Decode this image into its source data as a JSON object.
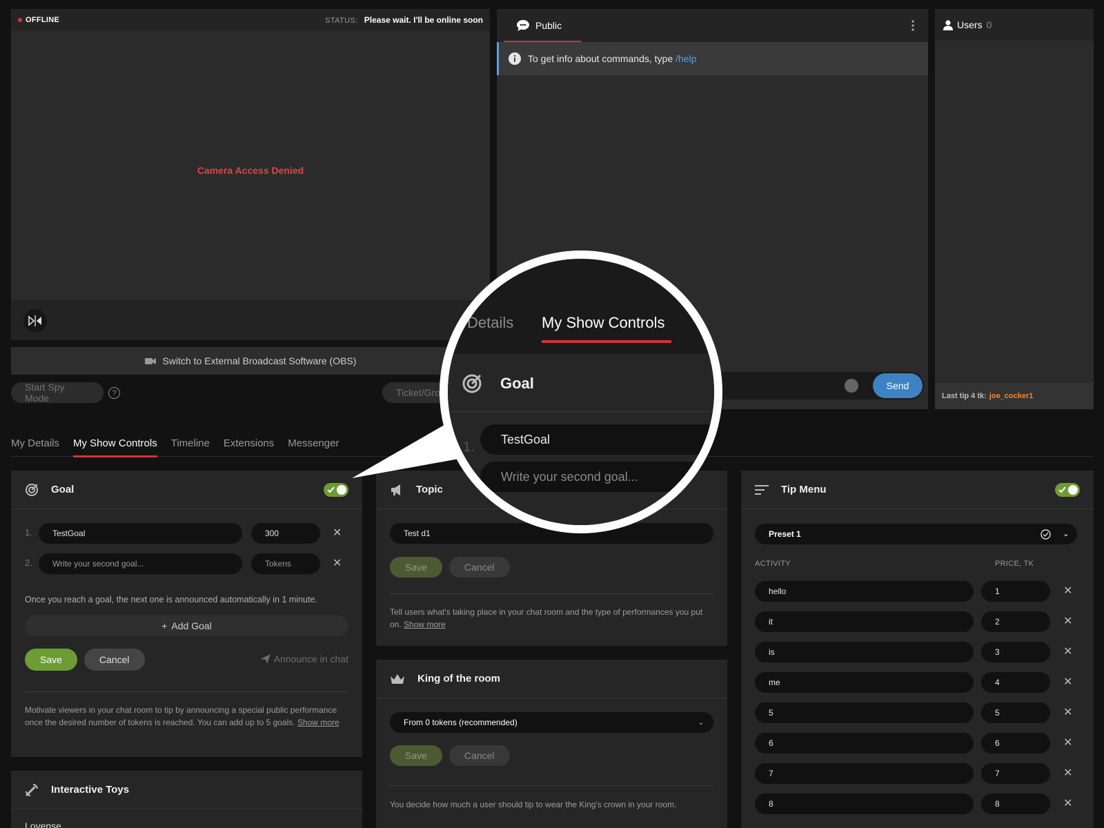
{
  "video": {
    "offline_label": "OFFLINE",
    "status_label": "STATUS:",
    "status_text": "Please wait. I'll be online soon",
    "camera_message": "Camera Access Denied",
    "obs_label": "Switch to External Broadcast Software (OBS)",
    "spy_mode": "Start Spy Mode",
    "help_glyph": "?",
    "ticket_label": "Ticket/Grou"
  },
  "chat": {
    "tab_label": "Public",
    "info_text": "To get info about commands, type",
    "info_command": "/help",
    "send_label": "Send"
  },
  "users": {
    "title": "Users",
    "count": "0",
    "last_tip_label": "Last tip 4 tk:",
    "last_tip_user": "joe_cocker1"
  },
  "tabs": [
    "My Details",
    "My Show Controls",
    "Timeline",
    "Extensions",
    "Messenger"
  ],
  "goal": {
    "title": "Goal",
    "enabled": true,
    "rows": [
      {
        "num": "1.",
        "text": "TestGoal",
        "amount": "300",
        "amount_is_placeholder": false,
        "text_is_placeholder": false
      },
      {
        "num": "2.",
        "text": "Write your second goal...",
        "amount": "Tokens",
        "amount_is_placeholder": true,
        "text_is_placeholder": true
      }
    ],
    "note": "Once you reach a goal, the next one is announced automatically in 1 minute.",
    "add_label": "Add Goal",
    "save": "Save",
    "cancel": "Cancel",
    "announce": "Announce in chat",
    "description": "Motivate viewers in your chat room to tip by announcing a special public performance once the desired number of tokens is reached. You can add up to 5 goals.",
    "show_more": "Show more"
  },
  "toys": {
    "title": "Interactive Toys",
    "first_item": "Lovense"
  },
  "topic": {
    "title": "Topic",
    "value": "Test d1",
    "save": "Save",
    "cancel": "Cancel",
    "description": "Tell users what's taking place in your chat room and the type of performances you put on.",
    "show_more": "Show more"
  },
  "king": {
    "title": "King of the room",
    "selected": "From 0 tokens (recommended)",
    "save": "Save",
    "cancel": "Cancel",
    "description": "You decide how much a user should tip to wear the King's crown in your room."
  },
  "tipmenu": {
    "title": "Tip Menu",
    "enabled": true,
    "preset": "Preset 1",
    "col_activity": "ACTIVITY",
    "col_price": "PRICE, TK",
    "rows": [
      {
        "activity": "hello",
        "price": "1"
      },
      {
        "activity": "it",
        "price": "2"
      },
      {
        "activity": "is",
        "price": "3"
      },
      {
        "activity": "me",
        "price": "4"
      },
      {
        "activity": "5",
        "price": "5"
      },
      {
        "activity": "6",
        "price": "6"
      },
      {
        "activity": "7",
        "price": "7"
      },
      {
        "activity": "8",
        "price": "8"
      }
    ]
  },
  "magnifier": {
    "tab_prev": "Details",
    "tab_active": "My Show Controls",
    "card_title": "Goal",
    "row_num": "1.",
    "row_value": "TestGoal",
    "row2_placeholder": "Write your second goal..."
  },
  "colors": {
    "accent_red": "#d6323b",
    "toggle_green": "#6e9c34",
    "send_blue": "#3f82c4",
    "link_blue": "#5aa0e6",
    "tip_user_orange": "#ef8a2c"
  }
}
